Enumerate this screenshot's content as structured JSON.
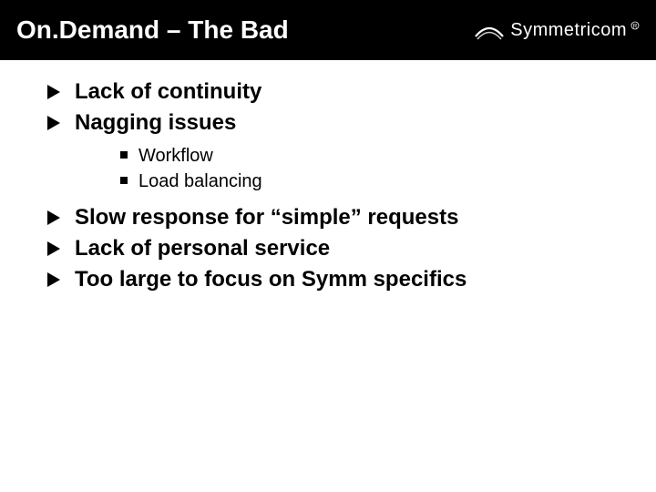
{
  "title": "On.Demand – The Bad",
  "brand": "Symmetricom",
  "bullets": {
    "b0": "Lack of continuity",
    "b1": "Nagging issues",
    "b2": "Slow response for “simple” requests",
    "b3": "Lack of personal service",
    "b4": "Too large to focus on Symm specifics"
  },
  "subs": {
    "s0": "Workflow",
    "s1": "Load balancing"
  }
}
